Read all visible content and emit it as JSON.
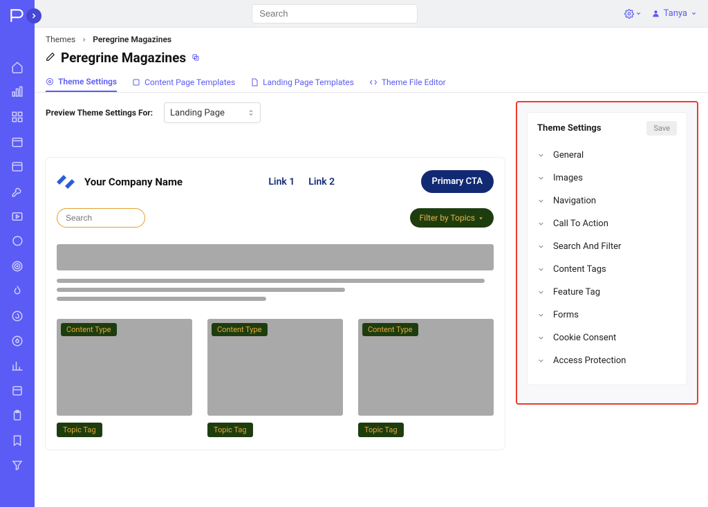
{
  "topbar": {
    "search_placeholder": "Search",
    "user_name": "Tanya"
  },
  "breadcrumb": {
    "root": "Themes",
    "current": "Peregrine Magazines"
  },
  "page_title": "Peregrine Magazines",
  "tabs": [
    {
      "label": "Theme Settings"
    },
    {
      "label": "Content Page Templates"
    },
    {
      "label": "Landing Page Templates"
    },
    {
      "label": "Theme File Editor"
    }
  ],
  "preview_for": {
    "label": "Preview Theme Settings For:",
    "selected": "Landing Page"
  },
  "preview": {
    "company_name": "Your Company Name",
    "link1": "Link 1",
    "link2": "Link 2",
    "cta": "Primary CTA",
    "search_placeholder": "Search",
    "filter_label": "Filter by Topics",
    "content_type_label": "Content Type",
    "topic_tag_label": "Topic Tag"
  },
  "panel": {
    "title": "Theme Settings",
    "save_label": "Save",
    "items": [
      "General",
      "Images",
      "Navigation",
      "Call To Action",
      "Search And Filter",
      "Content Tags",
      "Feature Tag",
      "Forms",
      "Cookie Consent",
      "Access Protection"
    ]
  }
}
